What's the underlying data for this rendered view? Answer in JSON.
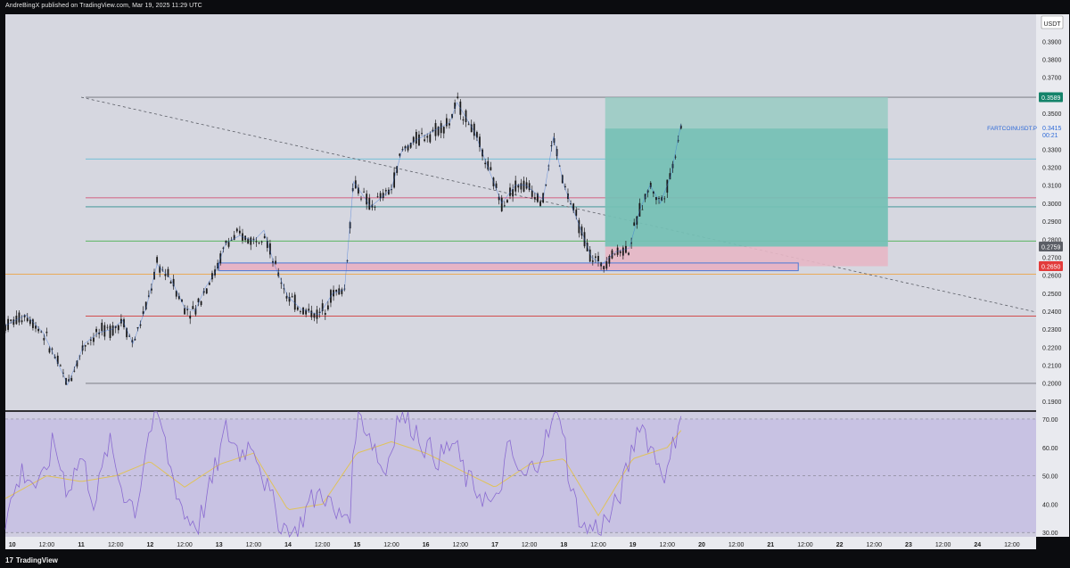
{
  "header": {
    "published_text": "AndreBingX published on TradingView.com, Mar 19, 2025 11:29 UTC"
  },
  "brand": {
    "logo_text": "17",
    "name": "TradingView"
  },
  "price_axis": {
    "currency": "USDT",
    "ticks": [
      "0.3900",
      "0.3800",
      "0.3700",
      "0.3600",
      "0.3500",
      "0.3300",
      "0.3200",
      "0.3100",
      "0.3000",
      "0.2900",
      "0.2800",
      "0.2700",
      "0.2600",
      "0.2500",
      "0.2400",
      "0.2300",
      "0.2200",
      "0.2100",
      "0.2000",
      "0.1900"
    ],
    "badges": {
      "target": {
        "label": "0.3589",
        "color": "#14836a"
      },
      "symbol": {
        "label": "FARTCOINUSDT.P",
        "price": "0.3415",
        "countdown": "00:21",
        "color": "#2f6bd8"
      },
      "entry": {
        "label": "0.2759",
        "color": "#5b5e66"
      },
      "stop": {
        "label": "0.2650",
        "color": "#e23b3b"
      }
    }
  },
  "rsi_axis": {
    "ticks": [
      "70.00",
      "60.00",
      "50.00",
      "40.00",
      "30.00"
    ]
  },
  "time_axis": {
    "labels": [
      "10",
      "12:00",
      "11",
      "12:00",
      "12",
      "12:00",
      "13",
      "12:00",
      "14",
      "12:00",
      "15",
      "12:00",
      "16",
      "12:00",
      "17",
      "12:00",
      "18",
      "12:00",
      "19",
      "12:00",
      "20",
      "12:00",
      "21",
      "12:00",
      "22",
      "12:00",
      "23",
      "12:00",
      "24",
      "12:00"
    ]
  },
  "colors": {
    "background": "#d6d7e0",
    "rsi_background": "#cfcde0",
    "rsi_band": "#c8c2e3",
    "candle": "#1a1a1a",
    "wick_line": "#2f6bd8",
    "rsi_line": "#8a6bd1",
    "rsi_ma": "#e0c25a",
    "target_zone": "#8fc9bf",
    "stop_zone": "#e7b7c5",
    "demand_box": "#e6b4c6",
    "demand_border": "#4b78d6"
  },
  "chart_data": [
    {
      "type": "candlestick",
      "symbol": "FARTCOINUSDT.P",
      "ylim": [
        0.185,
        0.405
      ],
      "x_labels": [
        "10",
        "11",
        "12",
        "13",
        "14",
        "15",
        "16",
        "17",
        "18",
        "19",
        "20",
        "21",
        "22",
        "23",
        "24"
      ],
      "x_range_days": [
        9.9,
        24.85
      ],
      "path": [
        [
          9.9,
          0.232
        ],
        [
          10.2,
          0.238
        ],
        [
          10.45,
          0.228
        ],
        [
          10.75,
          0.204
        ],
        [
          10.8,
          0.199
        ],
        [
          11.05,
          0.222
        ],
        [
          11.25,
          0.228
        ],
        [
          11.45,
          0.23
        ],
        [
          11.6,
          0.235
        ],
        [
          11.75,
          0.222
        ],
        [
          11.95,
          0.243
        ],
        [
          12.1,
          0.266
        ],
        [
          12.3,
          0.258
        ],
        [
          12.5,
          0.242
        ],
        [
          12.65,
          0.24
        ],
        [
          12.8,
          0.253
        ],
        [
          12.95,
          0.262
        ],
        [
          13.1,
          0.278
        ],
        [
          13.3,
          0.282
        ],
        [
          13.5,
          0.279
        ],
        [
          13.65,
          0.285
        ],
        [
          13.8,
          0.266
        ],
        [
          14.0,
          0.248
        ],
        [
          14.2,
          0.241
        ],
        [
          14.45,
          0.238
        ],
        [
          14.65,
          0.25
        ],
        [
          14.82,
          0.252
        ],
        [
          14.95,
          0.312
        ],
        [
          15.2,
          0.298
        ],
        [
          15.5,
          0.308
        ],
        [
          15.65,
          0.329
        ],
        [
          15.85,
          0.335
        ],
        [
          16.1,
          0.34
        ],
        [
          16.35,
          0.345
        ],
        [
          16.45,
          0.356
        ],
        [
          16.7,
          0.34
        ],
        [
          16.95,
          0.315
        ],
        [
          17.1,
          0.3
        ],
        [
          17.3,
          0.31
        ],
        [
          17.45,
          0.31
        ],
        [
          17.7,
          0.302
        ],
        [
          17.85,
          0.337
        ],
        [
          18.0,
          0.31
        ],
        [
          18.2,
          0.29
        ],
        [
          18.4,
          0.27
        ],
        [
          18.55,
          0.266
        ],
        [
          18.75,
          0.273
        ],
        [
          18.95,
          0.275
        ],
        [
          19.1,
          0.296
        ],
        [
          19.25,
          0.31
        ],
        [
          19.4,
          0.3
        ],
        [
          19.55,
          0.315
        ],
        [
          19.7,
          0.344
        ]
      ]
    },
    {
      "type": "line",
      "name": "RSI",
      "ylim": [
        28.5,
        72.5
      ],
      "reference_lines": [
        70,
        50,
        30
      ],
      "path": [
        [
          9.9,
          35
        ],
        [
          10.15,
          52
        ],
        [
          10.4,
          45
        ],
        [
          10.6,
          62
        ],
        [
          10.8,
          45
        ],
        [
          11.0,
          57
        ],
        [
          11.2,
          40
        ],
        [
          11.4,
          62
        ],
        [
          11.6,
          45
        ],
        [
          11.8,
          38
        ],
        [
          11.95,
          62
        ],
        [
          12.1,
          74
        ],
        [
          12.3,
          52
        ],
        [
          12.5,
          36
        ],
        [
          12.7,
          33
        ],
        [
          12.9,
          48
        ],
        [
          13.1,
          66
        ],
        [
          13.3,
          58
        ],
        [
          13.5,
          62
        ],
        [
          13.7,
          45
        ],
        [
          13.9,
          33
        ],
        [
          14.1,
          29
        ],
        [
          14.3,
          40
        ],
        [
          14.5,
          45
        ],
        [
          14.7,
          35
        ],
        [
          14.9,
          38
        ],
        [
          15.0,
          74
        ],
        [
          15.2,
          64
        ],
        [
          15.4,
          50
        ],
        [
          15.6,
          72
        ],
        [
          15.8,
          68
        ],
        [
          16.0,
          60
        ],
        [
          16.2,
          56
        ],
        [
          16.4,
          62
        ],
        [
          16.6,
          48
        ],
        [
          16.8,
          44
        ],
        [
          17.0,
          38
        ],
        [
          17.2,
          60
        ],
        [
          17.4,
          48
        ],
        [
          17.6,
          55
        ],
        [
          17.8,
          66
        ],
        [
          17.95,
          74
        ],
        [
          18.1,
          45
        ],
        [
          18.3,
          31
        ],
        [
          18.5,
          32
        ],
        [
          18.7,
          36
        ],
        [
          18.9,
          50
        ],
        [
          19.1,
          70
        ],
        [
          19.3,
          58
        ],
        [
          19.5,
          50
        ],
        [
          19.7,
          74
        ]
      ],
      "ma_path": [
        [
          9.9,
          42
        ],
        [
          10.5,
          50
        ],
        [
          11.0,
          48
        ],
        [
          11.5,
          50
        ],
        [
          12.0,
          55
        ],
        [
          12.5,
          46
        ],
        [
          13.0,
          54
        ],
        [
          13.5,
          58
        ],
        [
          14.0,
          38
        ],
        [
          14.5,
          40
        ],
        [
          15.0,
          58
        ],
        [
          15.5,
          62
        ],
        [
          16.0,
          58
        ],
        [
          16.5,
          52
        ],
        [
          17.0,
          46
        ],
        [
          17.5,
          54
        ],
        [
          18.0,
          56
        ],
        [
          18.5,
          36
        ],
        [
          19.0,
          56
        ],
        [
          19.5,
          60
        ],
        [
          19.7,
          66
        ]
      ]
    }
  ]
}
